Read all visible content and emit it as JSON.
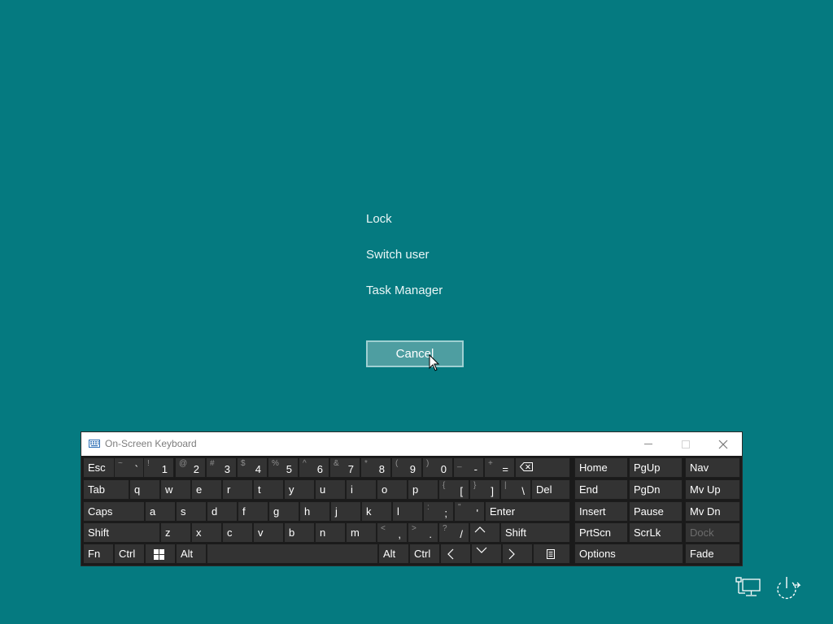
{
  "menu": {
    "items": [
      {
        "label": "Lock"
      },
      {
        "label": "Switch user"
      },
      {
        "label": "Task Manager"
      }
    ],
    "cancel_label": "Cancel"
  },
  "osk": {
    "title": "On-Screen Keyboard",
    "title_icon": "keyboard-icon",
    "window_controls": [
      "minimize-icon",
      "maximize-icon",
      "close-icon"
    ],
    "rows": {
      "row1": {
        "esc": "Esc",
        "pairs": [
          {
            "shift": "~",
            "main": "`"
          },
          {
            "shift": "!",
            "main": "1"
          },
          {
            "shift": "@",
            "main": "2"
          },
          {
            "shift": "#",
            "main": "3"
          },
          {
            "shift": "$",
            "main": "4"
          },
          {
            "shift": "%",
            "main": "5"
          },
          {
            "shift": "^",
            "main": "6"
          },
          {
            "shift": "&",
            "main": "7"
          },
          {
            "shift": "*",
            "main": "8"
          },
          {
            "shift": "(",
            "main": "9"
          },
          {
            "shift": ")",
            "main": "0"
          },
          {
            "shift": "_",
            "main": "-"
          },
          {
            "shift": "+",
            "main": "="
          }
        ],
        "backspace_icon": "backspace-icon"
      },
      "row2": {
        "tab": "Tab",
        "letters": [
          "q",
          "w",
          "e",
          "r",
          "t",
          "y",
          "u",
          "i",
          "o",
          "p"
        ],
        "pairs": [
          {
            "shift": "{",
            "main": "["
          },
          {
            "shift": "}",
            "main": "]"
          },
          {
            "shift": "|",
            "main": "\\"
          }
        ],
        "del": "Del"
      },
      "row3": {
        "caps": "Caps",
        "letters": [
          "a",
          "s",
          "d",
          "f",
          "g",
          "h",
          "j",
          "k",
          "l"
        ],
        "pairs": [
          {
            "shift": ":",
            "main": ";"
          },
          {
            "shift": "\"",
            "main": "'"
          }
        ],
        "enter": "Enter"
      },
      "row4": {
        "shift": "Shift",
        "letters": [
          "z",
          "x",
          "c",
          "v",
          "b",
          "n",
          "m"
        ],
        "pairs": [
          {
            "shift": "<",
            "main": ","
          },
          {
            "shift": ">",
            "main": "."
          },
          {
            "shift": "?",
            "main": "/"
          }
        ],
        "up_icon": "arrow-up-icon",
        "shift_right": "Shift"
      },
      "row5": {
        "fn": "Fn",
        "ctrl": "Ctrl",
        "win_icon": "windows-logo-icon",
        "alt": "Alt",
        "alt_right": "Alt",
        "ctrl_right": "Ctrl",
        "left_icon": "arrow-left-icon",
        "down_icon": "arrow-down-icon",
        "right_icon": "arrow-right-icon",
        "menu_icon": "context-menu-icon"
      }
    },
    "nav_keys": {
      "home": "Home",
      "pgup": "PgUp",
      "nav": "Nav",
      "end": "End",
      "pgdn": "PgDn",
      "mvup": "Mv Up",
      "insert": "Insert",
      "pause": "Pause",
      "mvdn": "Mv Dn",
      "prtscn": "PrtScn",
      "scrlk": "ScrLk",
      "dock": "Dock",
      "options": "Options",
      "fade": "Fade"
    }
  },
  "tray": {
    "network_icon": "network-icon",
    "power_icon": "power-icon"
  },
  "colors": {
    "background": "#057a80",
    "key_bg": "#333333",
    "keyboard_bg": "#1a1a1a",
    "cancel_bg": "#4e9ea1",
    "cancel_border": "#9fd0d2"
  }
}
